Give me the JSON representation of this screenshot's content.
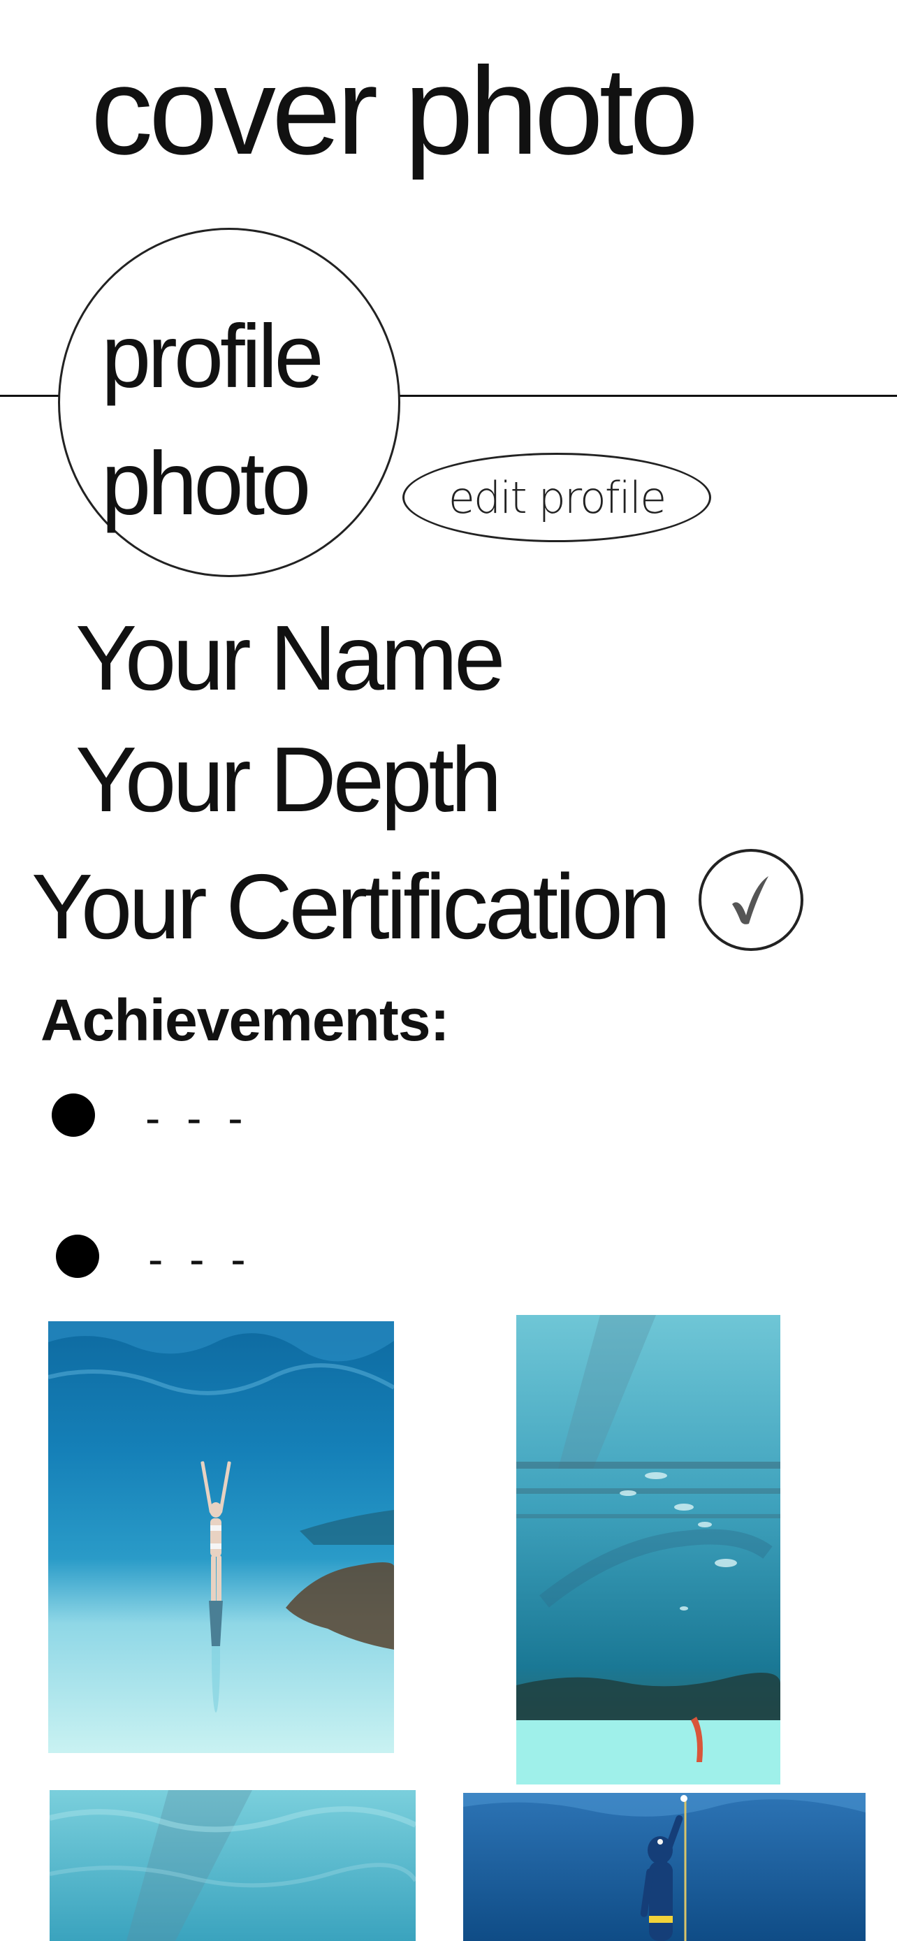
{
  "cover": {
    "label": "cover photo"
  },
  "profile": {
    "line1": "profile",
    "line2": "photo"
  },
  "edit_profile": {
    "label": "edit profile"
  },
  "fields": {
    "name": "Your Name",
    "depth": "Your Depth",
    "certification": "Your Certification"
  },
  "achievements": {
    "title": "Achievements:",
    "items": [
      "- - -",
      "- - -"
    ]
  },
  "icons": {
    "verified": "check-icon"
  },
  "colors": {
    "ink": "#111111",
    "water_deep": "#0b5c8e",
    "water_light": "#5fc6d8",
    "sand": "#bfeef0"
  }
}
